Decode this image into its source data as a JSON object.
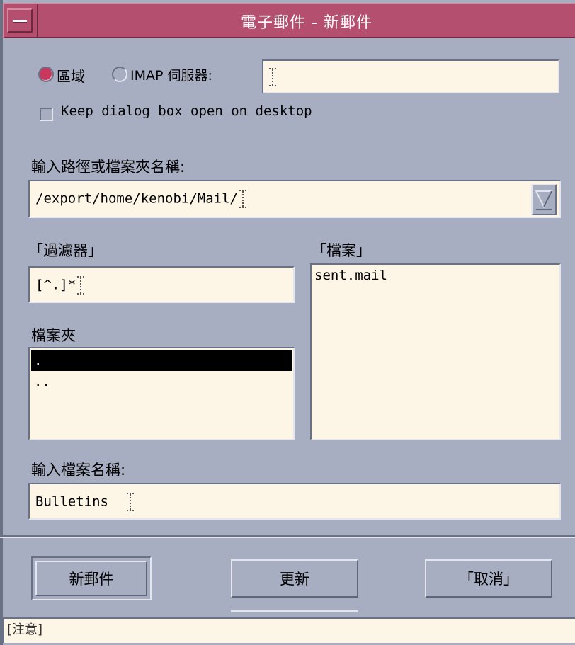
{
  "window": {
    "title": "電子郵件 - 新郵件"
  },
  "server": {
    "local_label": "區域",
    "imap_label": "IMAP 伺服器:",
    "selected": "local",
    "server_value": ""
  },
  "keep_open": {
    "label": "Keep dialog box open on desktop",
    "checked": false
  },
  "path": {
    "label": "輸入路徑或檔案夾名稱:",
    "value": "/export/home/kenobi/Mail/"
  },
  "filter": {
    "label": "「過濾器」",
    "value": "[^.]*"
  },
  "files": {
    "label": "「檔案」",
    "items": [
      "sent.mail"
    ]
  },
  "folders": {
    "label": "檔案夾",
    "items": [
      ".",
      ".."
    ],
    "selected_index": 0
  },
  "filename": {
    "label": "輸入檔案名稱:",
    "value": "Bulletins"
  },
  "buttons": {
    "new_mail": "新郵件",
    "update": "更新",
    "cancel": "「取消」"
  },
  "status": {
    "text": "[注意]"
  },
  "colors": {
    "titlebar": "#b44f70",
    "background": "#a7aec2",
    "field": "#fdf5e6",
    "radio_on": "#c8385e"
  }
}
